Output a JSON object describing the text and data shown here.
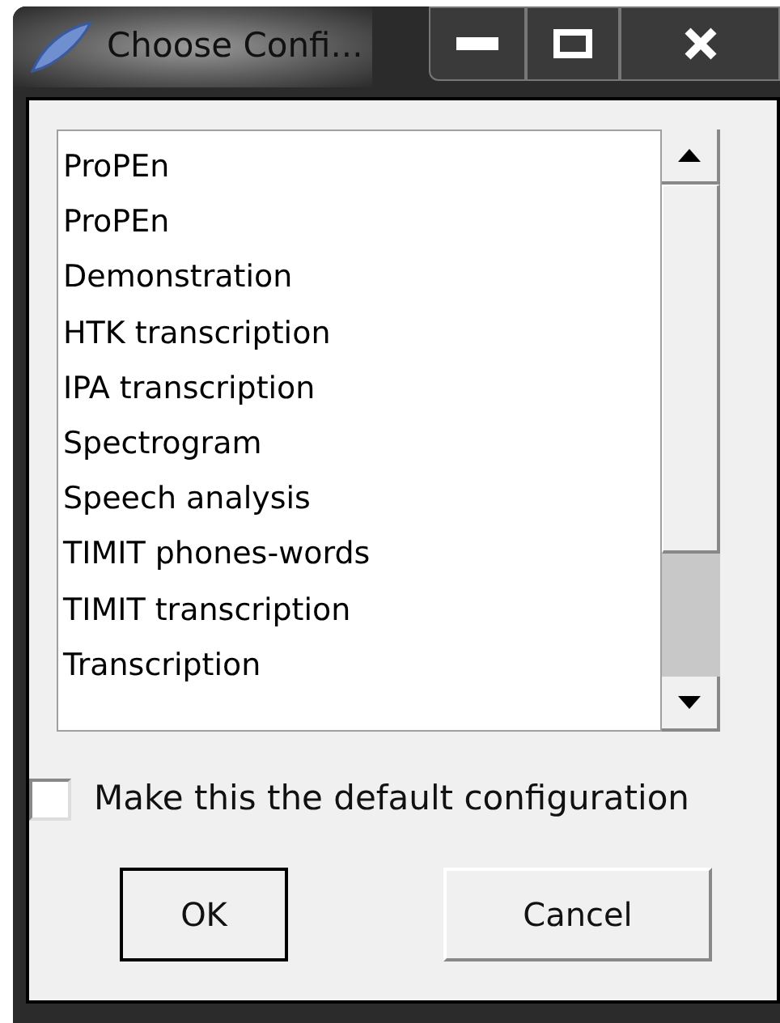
{
  "window": {
    "title": "Choose Confi..."
  },
  "list": {
    "items": [
      {
        "label": "ProPEn"
      },
      {
        "label": "ProPEn"
      },
      {
        "label": "Demonstration"
      },
      {
        "label": "HTK transcription"
      },
      {
        "label": "IPA transcription"
      },
      {
        "label": "Spectrogram"
      },
      {
        "label": "Speech analysis"
      },
      {
        "label": "TIMIT phones-words"
      },
      {
        "label": "TIMIT transcription"
      },
      {
        "label": "Transcription"
      }
    ]
  },
  "default_checkbox": {
    "label": "Make this the default configuration",
    "checked": false
  },
  "buttons": [
    {
      "label": "OK",
      "focused": true
    },
    {
      "label": "Cancel",
      "focused": false
    }
  ]
}
